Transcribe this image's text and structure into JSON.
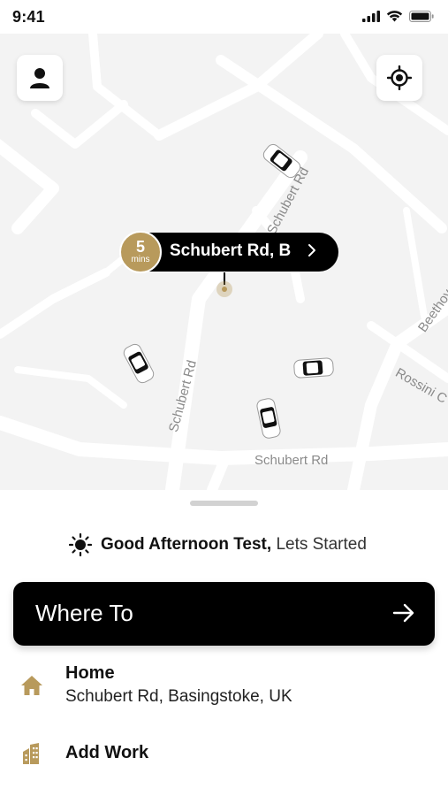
{
  "status": {
    "time": "9:41",
    "icons": [
      "signal-icon",
      "wifi-icon",
      "battery-icon"
    ]
  },
  "map": {
    "road_labels": [
      "Schubert Rd",
      "Schubert Rd",
      "Schubert Rd",
      "Beethov",
      "Rossini C"
    ],
    "pickup": {
      "eta_value": "5",
      "eta_unit": "mins",
      "address": "Schubert Rd, B"
    }
  },
  "greeting": {
    "bold": "Good Afternoon Test,",
    "rest": "Lets Started"
  },
  "where_to": {
    "label": "Where To"
  },
  "places": [
    {
      "icon": "home-icon",
      "title": "Home",
      "subtitle": "Schubert Rd, Basingstoke, UK"
    },
    {
      "icon": "work-building-icon",
      "title": "Add Work"
    }
  ],
  "colors": {
    "accent": "#b89a5c",
    "primary": "#000000",
    "map_bg": "#f3f3f3",
    "road": "#ffffff"
  }
}
